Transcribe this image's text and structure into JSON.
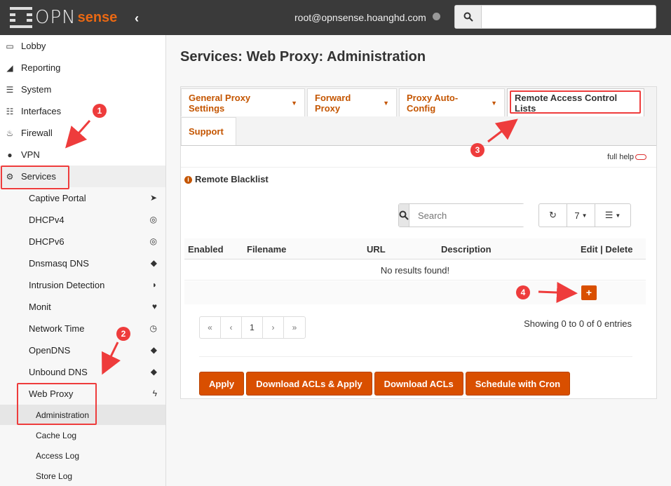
{
  "header": {
    "logo_text": "OPN",
    "logo_sense": "sense",
    "user": "root@opnsense.hoanghd.com",
    "search_placeholder": ""
  },
  "sidebar": {
    "items": [
      {
        "label": "Lobby",
        "icon": "laptop-icon"
      },
      {
        "label": "Reporting",
        "icon": "area-chart-icon"
      },
      {
        "label": "System",
        "icon": "server-icon"
      },
      {
        "label": "Interfaces",
        "icon": "sitemap-icon"
      },
      {
        "label": "Firewall",
        "icon": "fire-icon"
      },
      {
        "label": "VPN",
        "icon": "globe-icon"
      },
      {
        "label": "Services",
        "icon": "gear-icon"
      }
    ],
    "services": [
      {
        "label": "Captive Portal",
        "icon": "paper-plane-icon"
      },
      {
        "label": "DHCPv4",
        "icon": "bullseye-icon"
      },
      {
        "label": "DHCPv6",
        "icon": "bullseye-icon"
      },
      {
        "label": "Dnsmasq DNS",
        "icon": "tags-icon"
      },
      {
        "label": "Intrusion Detection",
        "icon": "shield-icon"
      },
      {
        "label": "Monit",
        "icon": "heartbeat-icon"
      },
      {
        "label": "Network Time",
        "icon": "clock-icon"
      },
      {
        "label": "OpenDNS",
        "icon": "tags-icon"
      },
      {
        "label": "Unbound DNS",
        "icon": "tags-icon"
      },
      {
        "label": "Web Proxy",
        "icon": "bolt-icon"
      }
    ],
    "webproxy": [
      {
        "label": "Administration"
      },
      {
        "label": "Cache Log"
      },
      {
        "label": "Access Log"
      },
      {
        "label": "Store Log"
      }
    ]
  },
  "page": {
    "title": "Services: Web Proxy: Administration",
    "tabs": [
      {
        "label": "General Proxy Settings"
      },
      {
        "label": "Forward Proxy"
      },
      {
        "label": "Proxy Auto-Config"
      },
      {
        "label": "Remote Access Control Lists"
      },
      {
        "label": "Support"
      }
    ],
    "full_help": "full help",
    "section_title": "Remote Blacklist",
    "search_placeholder": "Search",
    "page_size": "7",
    "columns": [
      "Enabled",
      "Filename",
      "URL",
      "Description",
      "Edit | Delete"
    ],
    "no_results": "No results found!",
    "add_label": "+",
    "pager": [
      "«",
      "‹",
      "1",
      "›",
      "»"
    ],
    "entries": "Showing 0 to 0 of 0 entries",
    "actions": [
      "Apply",
      "Download ACLs & Apply",
      "Download ACLs",
      "Schedule with Cron"
    ]
  },
  "annotations": [
    "1",
    "2",
    "3",
    "4"
  ],
  "colors": {
    "accent": "#d94f00",
    "topbar": "#3a3a3a",
    "annotation": "#ee3c3c"
  }
}
